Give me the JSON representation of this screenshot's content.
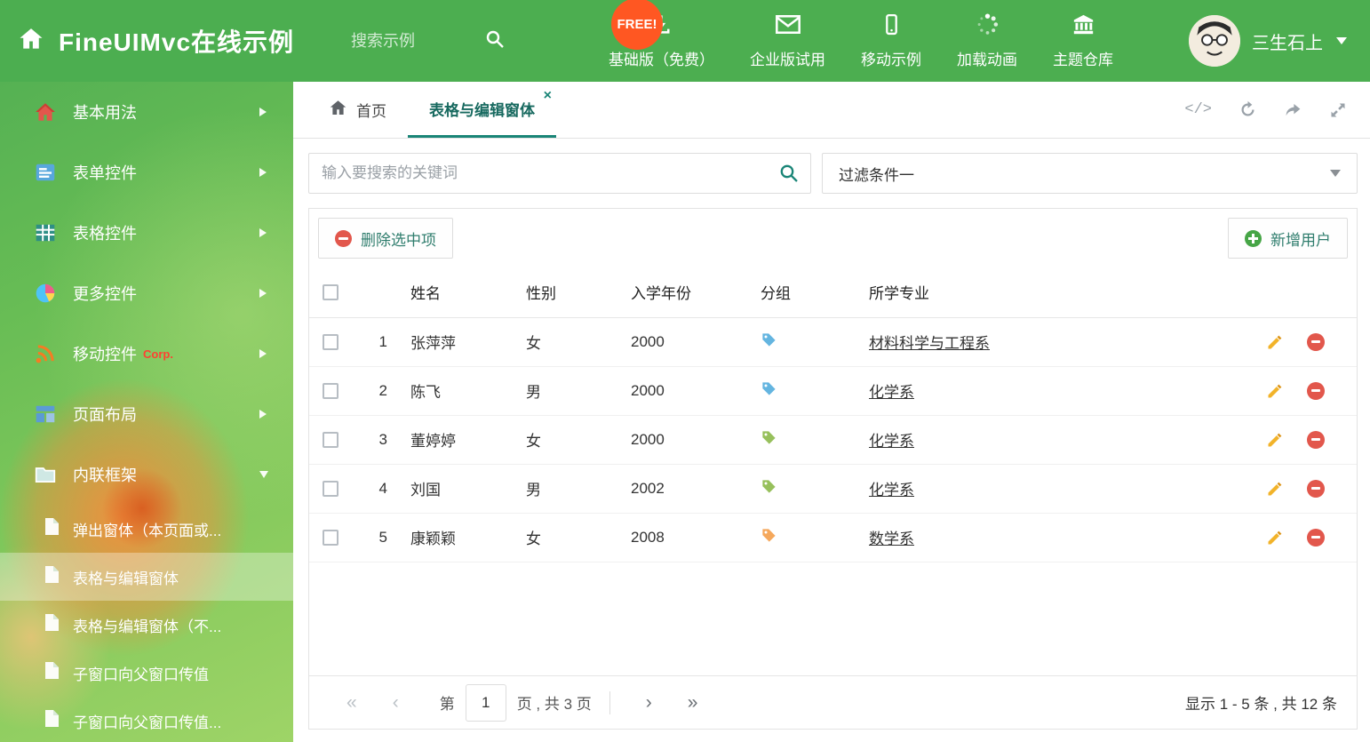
{
  "header": {
    "title": "FineUIMvc在线示例",
    "search_placeholder": "搜索示例",
    "free_badge": "FREE!",
    "nav": [
      {
        "label": "基础版（免费）"
      },
      {
        "label": "企业版试用"
      },
      {
        "label": "移动示例"
      },
      {
        "label": "加载动画"
      },
      {
        "label": "主题仓库"
      }
    ],
    "user_name": "三生石上"
  },
  "sidebar": {
    "items": [
      {
        "label": "基本用法"
      },
      {
        "label": "表单控件"
      },
      {
        "label": "表格控件"
      },
      {
        "label": "更多控件"
      },
      {
        "label": "移动控件",
        "badge": "Corp."
      },
      {
        "label": "页面布局"
      },
      {
        "label": "内联框架"
      }
    ],
    "subitems": [
      {
        "label": "弹出窗体（本页面或..."
      },
      {
        "label": "表格与编辑窗体"
      },
      {
        "label": "表格与编辑窗体（不..."
      },
      {
        "label": "子窗口向父窗口传值"
      },
      {
        "label": "子窗口向父窗口传值..."
      }
    ]
  },
  "tabs": {
    "home": "首页",
    "active": "表格与编辑窗体"
  },
  "filters": {
    "search_placeholder": "输入要搜索的关键词",
    "filter_value": "过滤条件一"
  },
  "toolbar": {
    "delete_label": "删除选中项",
    "add_label": "新增用户"
  },
  "table": {
    "headers": {
      "name": "姓名",
      "gender": "性别",
      "year": "入学年份",
      "group": "分组",
      "major": "所学专业"
    },
    "rows": [
      {
        "num": "1",
        "name": "张萍萍",
        "gender": "女",
        "year": "2000",
        "tag_color": "#64b5e0",
        "major": "材料科学与工程系"
      },
      {
        "num": "2",
        "name": "陈飞",
        "gender": "男",
        "year": "2000",
        "tag_color": "#64b5e0",
        "major": "化学系"
      },
      {
        "num": "3",
        "name": "董婷婷",
        "gender": "女",
        "year": "2000",
        "tag_color": "#97c05c",
        "major": "化学系"
      },
      {
        "num": "4",
        "name": "刘国",
        "gender": "男",
        "year": "2002",
        "tag_color": "#97c05c",
        "major": "化学系"
      },
      {
        "num": "5",
        "name": "康颖颖",
        "gender": "女",
        "year": "2008",
        "tag_color": "#f5a85c",
        "major": "数学系"
      }
    ]
  },
  "pagination": {
    "prefix": "第",
    "page": "1",
    "suffix": "页 , 共 3 页",
    "summary": "显示 1 - 5 条 , 共 12 条"
  },
  "colors": {
    "header_green": "#4cae50",
    "accent_teal": "#1a8577",
    "danger_red": "#e2574c",
    "success_green": "#46a546",
    "free_badge_orange": "#ff5722"
  }
}
